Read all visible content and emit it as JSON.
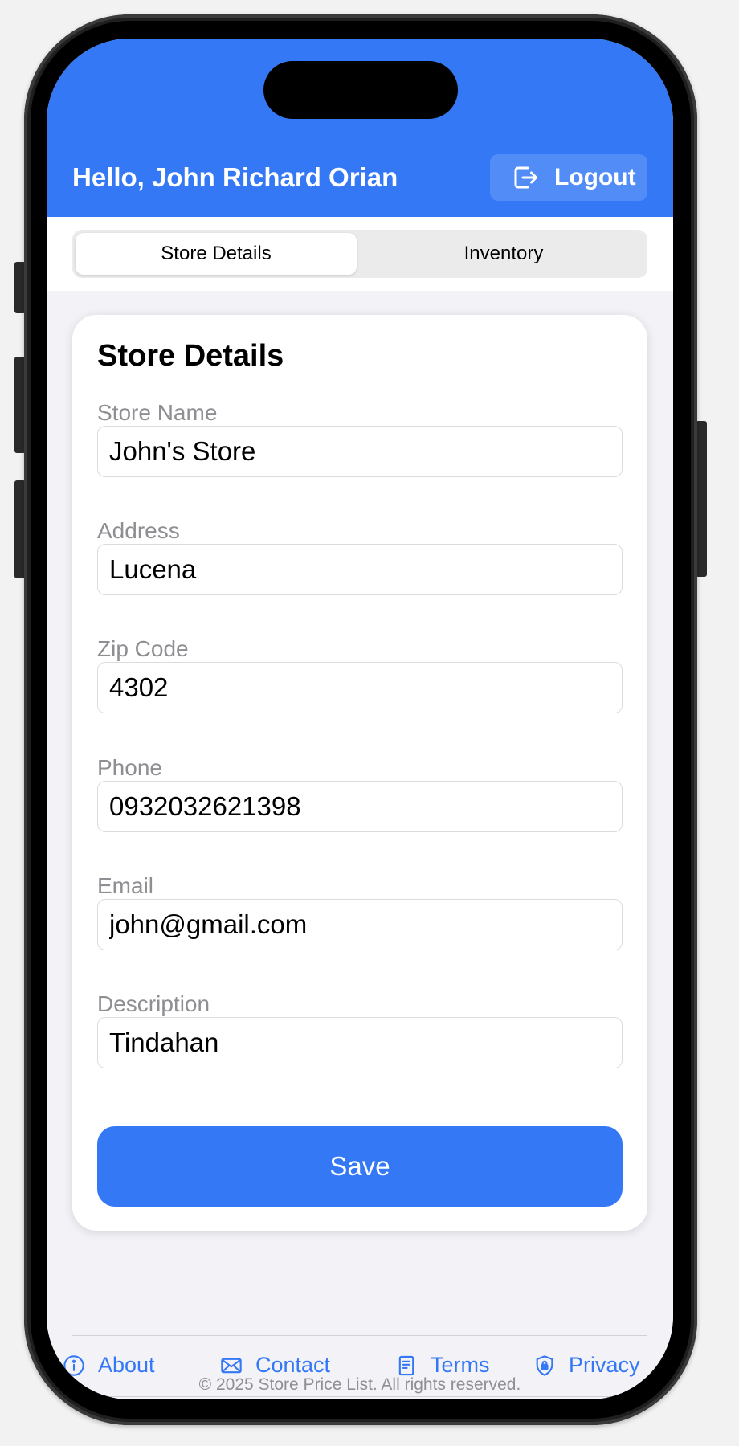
{
  "header": {
    "greeting": "Hello, John Richard Orian",
    "logout_label": "Logout"
  },
  "tabs": [
    {
      "label": "Store Details",
      "selected": true
    },
    {
      "label": "Inventory",
      "selected": false
    }
  ],
  "form": {
    "title": "Store Details",
    "fields": [
      {
        "label": "Store Name",
        "value": "John's Store"
      },
      {
        "label": "Address",
        "value": "Lucena"
      },
      {
        "label": "Zip Code",
        "value": "4302"
      },
      {
        "label": "Phone",
        "value": "0932032621398"
      },
      {
        "label": "Email",
        "value": "john@gmail.com"
      },
      {
        "label": "Description",
        "value": "Tindahan"
      }
    ],
    "save_label": "Save"
  },
  "footer": {
    "links": [
      {
        "label": "About",
        "icon": "info-icon"
      },
      {
        "label": "Contact",
        "icon": "envelope-icon"
      },
      {
        "label": "Terms",
        "icon": "document-icon"
      },
      {
        "label": "Privacy",
        "icon": "lock-shield-icon"
      }
    ],
    "copyright": "© 2025 Store Price List. All rights reserved."
  },
  "colors": {
    "accent": "#3478f6",
    "muted_text": "#8e8e93",
    "background": "#f2f2f7"
  }
}
